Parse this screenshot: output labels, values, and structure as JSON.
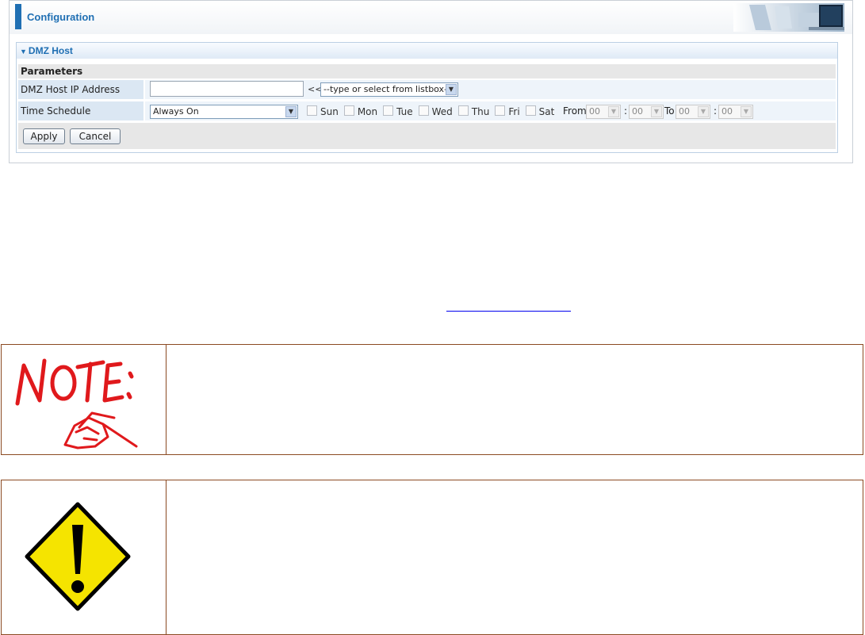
{
  "header": {
    "title": "Configuration"
  },
  "dmz": {
    "section_title": "DMZ Host",
    "params_label": "Parameters",
    "ip_label": "DMZ Host IP Address",
    "ip_value": "",
    "ip_separator": "<<",
    "listbox_value": "--type or select from listbox--",
    "schedule_label": "Time Schedule",
    "schedule_value": "Always On",
    "days": [
      "Sun",
      "Mon",
      "Tue",
      "Wed",
      "Thu",
      "Fri",
      "Sat"
    ],
    "from_label": "From",
    "to_label": "To",
    "colon": ":",
    "from_hour": "00",
    "from_min": "00",
    "to_hour": "00",
    "to_min": "00",
    "apply_label": "Apply",
    "cancel_label": "Cancel"
  },
  "icons": {
    "note": "note-icon",
    "warning": "warning-icon",
    "header_decor": "office-scene-icon"
  },
  "colors": {
    "accent": "#1f6fb3",
    "note_red": "#e0191c",
    "warn_yellow": "#f5e400",
    "box_border": "#8b4a22"
  }
}
